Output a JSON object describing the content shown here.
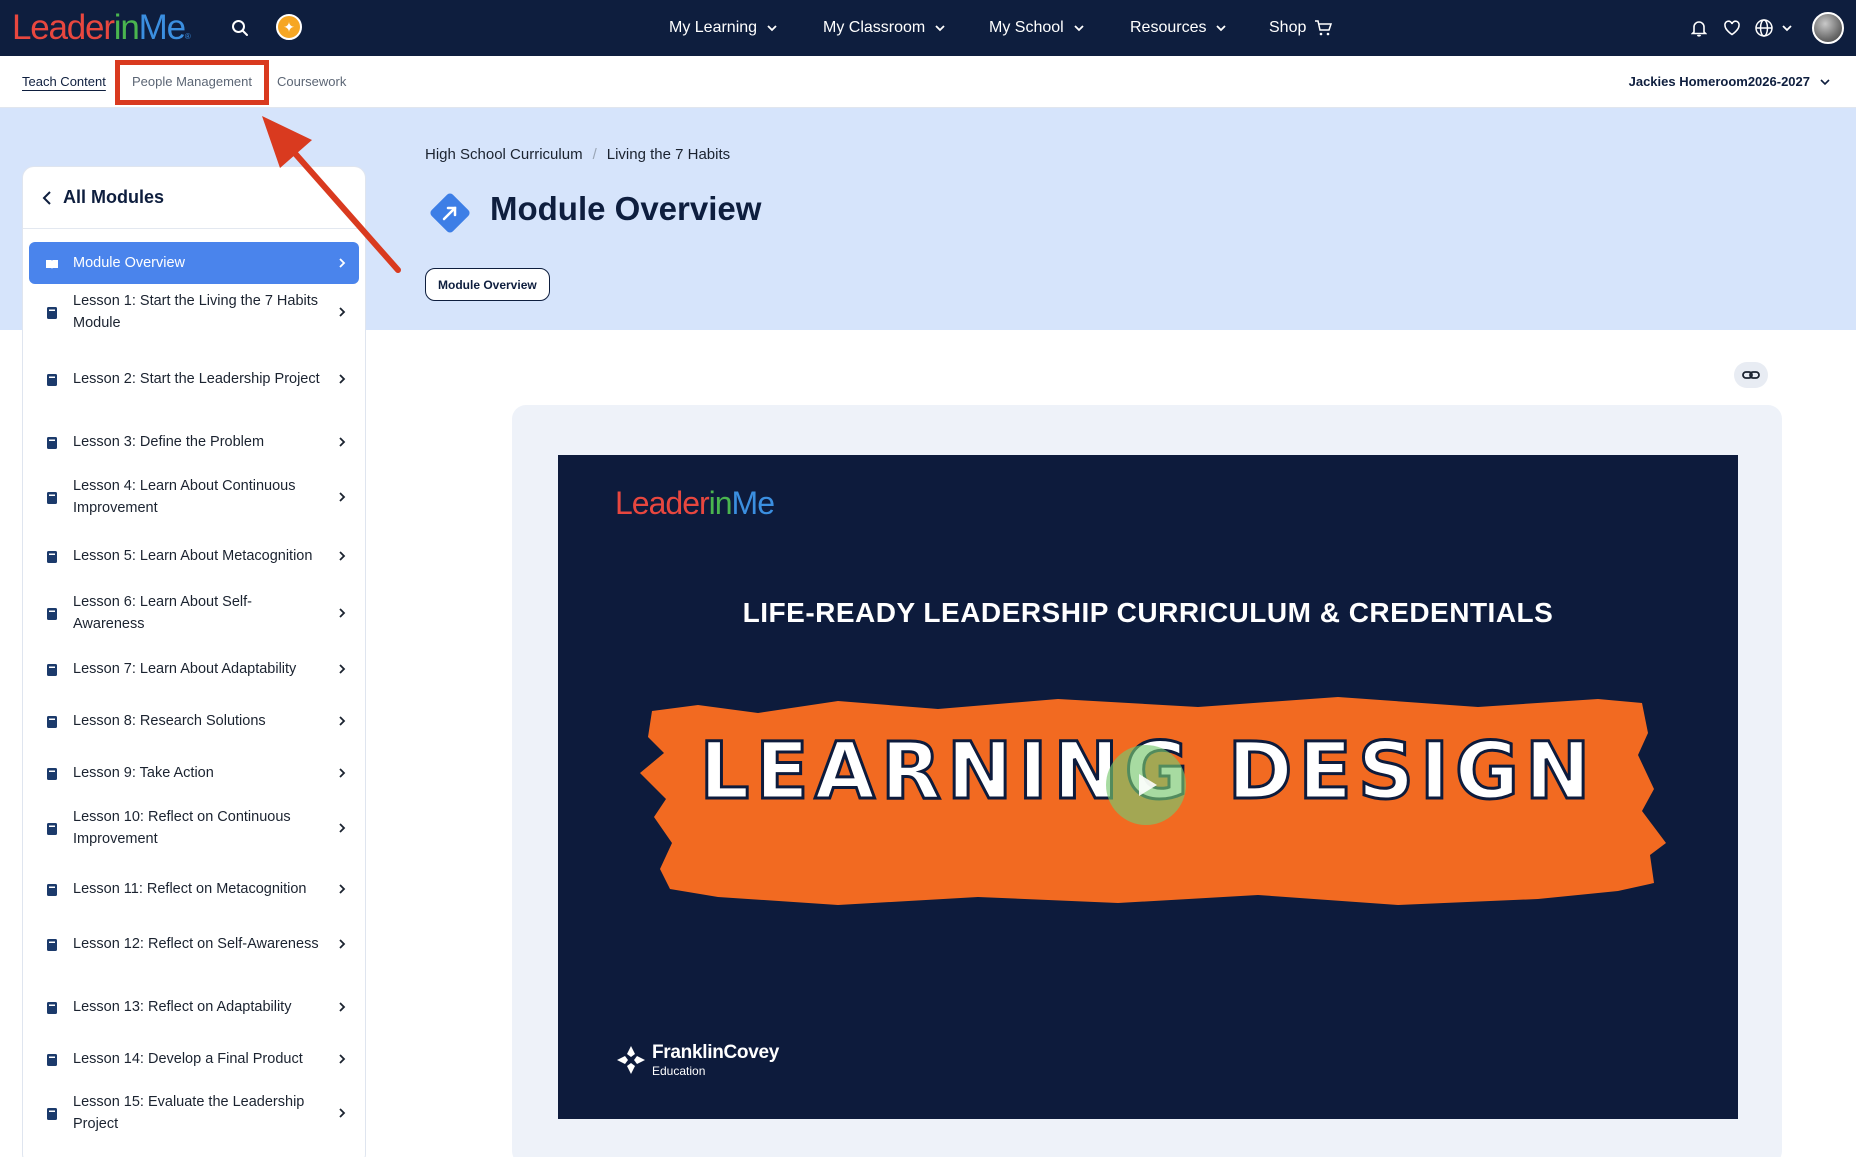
{
  "brand": {
    "logo_part1": "Leader",
    "logo_part2": "in",
    "logo_part3": "Me"
  },
  "nav": {
    "items": [
      {
        "label": "My Learning"
      },
      {
        "label": "My Classroom"
      },
      {
        "label": "My School"
      },
      {
        "label": "Resources"
      },
      {
        "label": "Shop"
      }
    ]
  },
  "subnav": {
    "tabs": [
      {
        "label": "Teach Content",
        "active": true
      },
      {
        "label": "People Management",
        "active": false
      },
      {
        "label": "Coursework",
        "active": false
      }
    ],
    "class_selector": "Jackies Homeroom2026-2027"
  },
  "breadcrumb": [
    "High School Curriculum",
    "Living the 7 Habits"
  ],
  "page": {
    "title": "Module Overview",
    "chip": "Module Overview"
  },
  "sidebar": {
    "back_label": "All Modules",
    "items": [
      {
        "label": "Module Overview",
        "active": true,
        "icon": "open-book-icon"
      },
      {
        "label": "Lesson 1: Start the Living the 7 Habits Module",
        "icon": "book-icon"
      },
      {
        "label": "Lesson 2: Start the Leadership Project",
        "icon": "book-icon"
      },
      {
        "label": "Lesson 3: Define the Problem",
        "icon": "book-icon"
      },
      {
        "label": "Lesson 4: Learn About Continuous Improvement",
        "icon": "book-icon"
      },
      {
        "label": "Lesson 5: Learn About Metacognition",
        "icon": "book-icon"
      },
      {
        "label": "Lesson 6: Learn About Self-Awareness",
        "icon": "book-icon"
      },
      {
        "label": "Lesson 7: Learn About Adaptability",
        "icon": "book-icon"
      },
      {
        "label": "Lesson 8: Research Solutions",
        "icon": "book-icon"
      },
      {
        "label": "Lesson 9: Take Action",
        "icon": "book-icon"
      },
      {
        "label": "Lesson 10: Reflect on Continuous Improvement",
        "icon": "book-icon"
      },
      {
        "label": "Lesson 11: Reflect on Metacognition",
        "icon": "book-icon"
      },
      {
        "label": "Lesson 12: Reflect on Self-Awareness",
        "icon": "book-icon"
      },
      {
        "label": "Lesson 13: Reflect on Adaptability",
        "icon": "book-icon"
      },
      {
        "label": "Lesson 14: Develop a Final Product",
        "icon": "book-icon"
      },
      {
        "label": "Lesson 15: Evaluate the Leadership Project",
        "icon": "book-icon"
      }
    ]
  },
  "video": {
    "logo_part1": "Leader",
    "logo_part2": "in",
    "logo_part3": "Me",
    "headline": "LIFE-READY LEADERSHIP CURRICULUM & CREDENTIALS",
    "banner_text": "LEARNING DESIGN",
    "footer_brand": "FranklinCovey",
    "footer_sub": "Education"
  },
  "colors": {
    "nav_bg": "#0e1e3e",
    "header_band": "#d6e4fb",
    "active_item": "#4a84ec",
    "annotation": "#d93a1f",
    "banner_orange": "#f26a21"
  }
}
